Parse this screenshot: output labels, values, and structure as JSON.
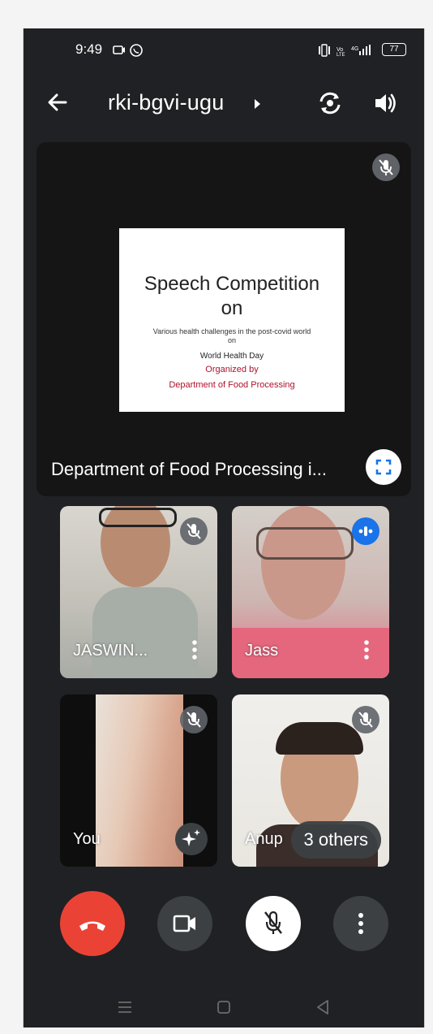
{
  "status_bar": {
    "time": "9:49",
    "battery": "77"
  },
  "top_bar": {
    "meeting_code": "rki-bgvi-ugu"
  },
  "presentation": {
    "slide": {
      "title_line1": "Speech Competition",
      "title_line2": "on",
      "subtitle": "Various health challenges in the post-covid world on",
      "day": "World Health Day",
      "organized_by": "Organized by",
      "department": "Department of Food Processing"
    },
    "presenter_name": "Department of Food Processing i..."
  },
  "participants": [
    {
      "name": "JASWIN...",
      "muted": true
    },
    {
      "name": "Jass",
      "speaking": true
    },
    {
      "name": "You",
      "muted": true
    },
    {
      "name": "Anup",
      "muted": true,
      "others_label": "3 others"
    }
  ],
  "colors": {
    "background": "#202124",
    "end_call": "#ea4335",
    "speaking": "#1a73e8",
    "slide_accent": "#b0112a"
  },
  "icons": [
    "back-arrow-icon",
    "chevron-right-icon",
    "flip-camera-icon",
    "speaker-icon",
    "mic-off-icon",
    "fullscreen-icon",
    "more-vert-icon",
    "sparkle-icon",
    "phone-hangup-icon",
    "video-camera-icon"
  ]
}
